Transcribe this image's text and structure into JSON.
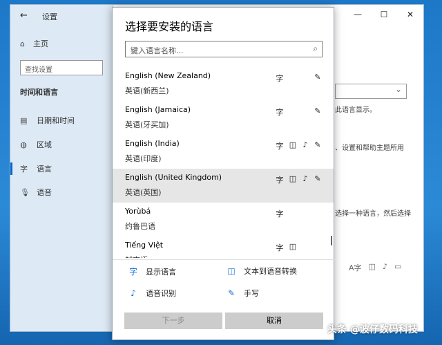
{
  "settings": {
    "back_icon": "back-arrow-icon",
    "title": "设置",
    "nav_home": "主页",
    "search_placeholder": "查找设置",
    "section": "时间和语言",
    "nav_items": [
      {
        "label": "日期和时间",
        "icon": "calendar-clock-icon"
      },
      {
        "label": "区域",
        "icon": "globe-icon"
      },
      {
        "label": "语言",
        "icon": "language-icon"
      },
      {
        "label": "语音",
        "icon": "microphone-icon"
      }
    ],
    "right_fragments": [
      "此语言显示。",
      "、设置和帮助主题所用",
      "选择一种语言，然后选择"
    ]
  },
  "dialog": {
    "title": "选择要安装的语言",
    "search_placeholder": "键入语言名称...",
    "languages": [
      {
        "name": "English (New Zealand)",
        "native": "英语(新西兰)",
        "features": [
          "display",
          "handwriting"
        ],
        "selected": false
      },
      {
        "name": "English (Jamaica)",
        "native": "英语(牙买加)",
        "features": [
          "display",
          "handwriting"
        ],
        "selected": false
      },
      {
        "name": "English (India)",
        "native": "英语(印度)",
        "features": [
          "display",
          "tts",
          "speech",
          "handwriting"
        ],
        "selected": false
      },
      {
        "name": "English (United Kingdom)",
        "native": "英语(英国)",
        "features": [
          "display",
          "tts",
          "speech",
          "handwriting"
        ],
        "selected": true
      },
      {
        "name": "Yorùbá",
        "native": "约鲁巴语",
        "features": [
          "display"
        ],
        "selected": false
      },
      {
        "name": "Tiếng Việt",
        "native": "越南语",
        "features": [
          "display",
          "tts"
        ],
        "selected": false
      }
    ],
    "legend": {
      "display": "显示语言",
      "tts": "文本到语音转换",
      "speech": "语音识别",
      "handwriting": "手写"
    },
    "buttons": {
      "next": "下一步",
      "cancel": "取消"
    }
  },
  "watermark": "头条 @波仔数码科技"
}
